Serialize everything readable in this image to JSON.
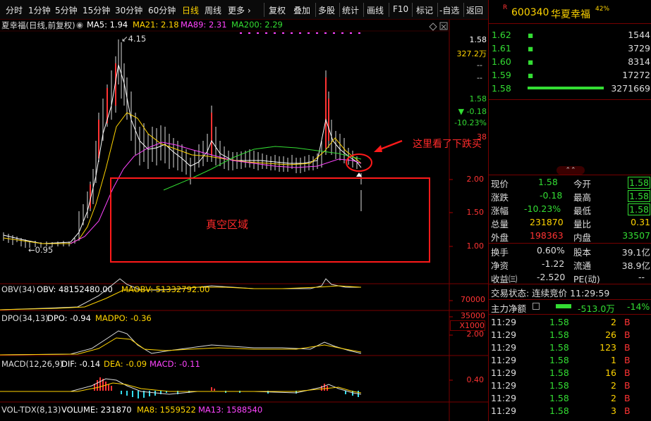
{
  "toolbar": {
    "items": [
      "分时",
      "1分钟",
      "5分钟",
      "15分钟",
      "30分钟",
      "60分钟",
      "日线",
      "周线",
      "更多 ›",
      "复权",
      "叠加",
      "多股",
      "统计",
      "画线",
      "F10",
      "标记",
      "-自选",
      "返回"
    ]
  },
  "main": {
    "title": "夏幸福(日线,前复权)",
    "ma5": "MA5: 1.94",
    "ma21": "MA21: 2.18",
    "ma89": "MA89: 2.31",
    "ma200": "MA200: 2.29",
    "high_label": "4.15",
    "low_label": "←0.95",
    "price_ticks": [
      "2.00",
      "1.50",
      "1.00"
    ],
    "top_price": "1.58",
    "top_vol": "327.2万",
    "dash1": "--",
    "dash2": "--",
    "info_price": "1.58",
    "info_change": "▼ -0.18",
    "info_pct": "-10.23%",
    "info_38": "38",
    "vacuum_label": "真空区域",
    "annotation": "这里看了下跌买"
  },
  "obv": {
    "title": "OBV(34)",
    "obv": "OBV: 48152480.00",
    "maobv": "MAOBV: 51332792.00",
    "ticks": [
      "70000",
      "35000"
    ],
    "unit": "X1000"
  },
  "dpo": {
    "title": "DPO(34,13)",
    "dpo": "DPO: -0.94",
    "madpo": "MADPO: -0.36",
    "tick": "2.00"
  },
  "macd": {
    "title": "MACD(12,26,9)",
    "dif": "DIF: -0.14",
    "dea": "DEA: -0.09",
    "macd": "MACD: -0.11",
    "tick": "0.40"
  },
  "vol": {
    "title": "VOL-TDX(8,13)",
    "volume": "VOLUME: 231870",
    "ma8": "MA8: 1559522",
    "ma13": "MA13: 1588540"
  },
  "quote": {
    "badge": "R",
    "code": "600340",
    "name": "华夏幸福",
    "pct": "42%",
    "book": [
      {
        "price": "1.62",
        "vol": "1544"
      },
      {
        "price": "1.61",
        "vol": "3729"
      },
      {
        "price": "1.60",
        "vol": "8314"
      },
      {
        "price": "1.59",
        "vol": "17272"
      },
      {
        "price": "1.58",
        "vol": "3271669"
      }
    ],
    "stats": [
      {
        "k1": "现价",
        "v1": "1.58",
        "k2": "今开",
        "v2": "1.58"
      },
      {
        "k1": "涨跌",
        "v1": "-0.18",
        "k2": "最高",
        "v2": "1.58"
      },
      {
        "k1": "涨幅",
        "v1": "-10.23%",
        "k2": "最低",
        "v2": "1.58"
      },
      {
        "k1": "总量",
        "v1": "231870",
        "k2": "量比",
        "v2": "0.31"
      },
      {
        "k1": "外盘",
        "v1": "198363",
        "k2": "内盘",
        "v2": "33507"
      }
    ],
    "stats2": [
      {
        "k1": "换手",
        "v1": "0.60%",
        "k2": "股本",
        "v2": "39.1亿"
      },
      {
        "k1": "净资",
        "v1": "-1.22",
        "k2": "流通",
        "v2": "38.9亿"
      },
      {
        "k1": "收益㈢",
        "v1": "-2.520",
        "k2": "PE(动)",
        "v2": "--"
      }
    ],
    "trade_status": "交易状态: 连续竞价 11:29:59",
    "main_flow_label": "主力净额",
    "main_flow_value": "-513.0万",
    "main_flow_pct": "-14%",
    "ticks": [
      {
        "t": "11:29",
        "p": "1.58",
        "v": "2",
        "s": "B"
      },
      {
        "t": "11:29",
        "p": "1.58",
        "v": "26",
        "s": "B"
      },
      {
        "t": "11:29",
        "p": "1.58",
        "v": "123",
        "s": "B"
      },
      {
        "t": "11:29",
        "p": "1.58",
        "v": "1",
        "s": "B"
      },
      {
        "t": "11:29",
        "p": "1.58",
        "v": "16",
        "s": "B"
      },
      {
        "t": "11:29",
        "p": "1.58",
        "v": "2",
        "s": "B"
      },
      {
        "t": "11:29",
        "p": "1.58",
        "v": "2",
        "s": "B"
      },
      {
        "t": "11:29",
        "p": "1.58",
        "v": "3",
        "s": "B"
      }
    ]
  },
  "colors": {
    "up": "#ff3333",
    "down": "#33dd33",
    "ma5": "#ffffff",
    "ma21": "#ffd400",
    "ma89": "#ff44ff",
    "ma200": "#33dd33",
    "frame": "#700000"
  }
}
